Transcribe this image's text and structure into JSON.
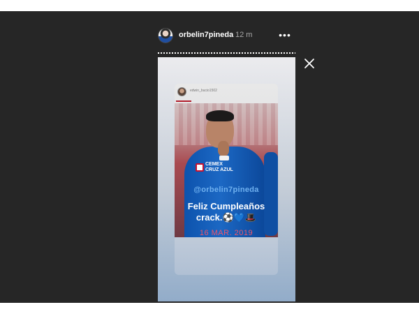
{
  "story": {
    "username": "orbelin7pineda",
    "time": "12 m",
    "more_label": "•••",
    "close_label": "Close"
  },
  "reshared_post": {
    "username": "edwin_bucio1502",
    "mention": "@orbelin7pineda",
    "caption_line1": "Feliz Cumpleaños",
    "caption_line2": "crack.⚽💙🎩",
    "date_stamp": "16 MAR. 2019",
    "jersey_sponsor_line1": "CEMEX",
    "jersey_sponsor_line2": "CRUZ AZUL"
  },
  "colors": {
    "viewer_bg": "#262626",
    "mention": "#6fb1f0",
    "date_stamp": "#f0566a",
    "jersey": "#0d53ad"
  },
  "icons": [
    "more-icon",
    "close-icon",
    "avatar"
  ]
}
